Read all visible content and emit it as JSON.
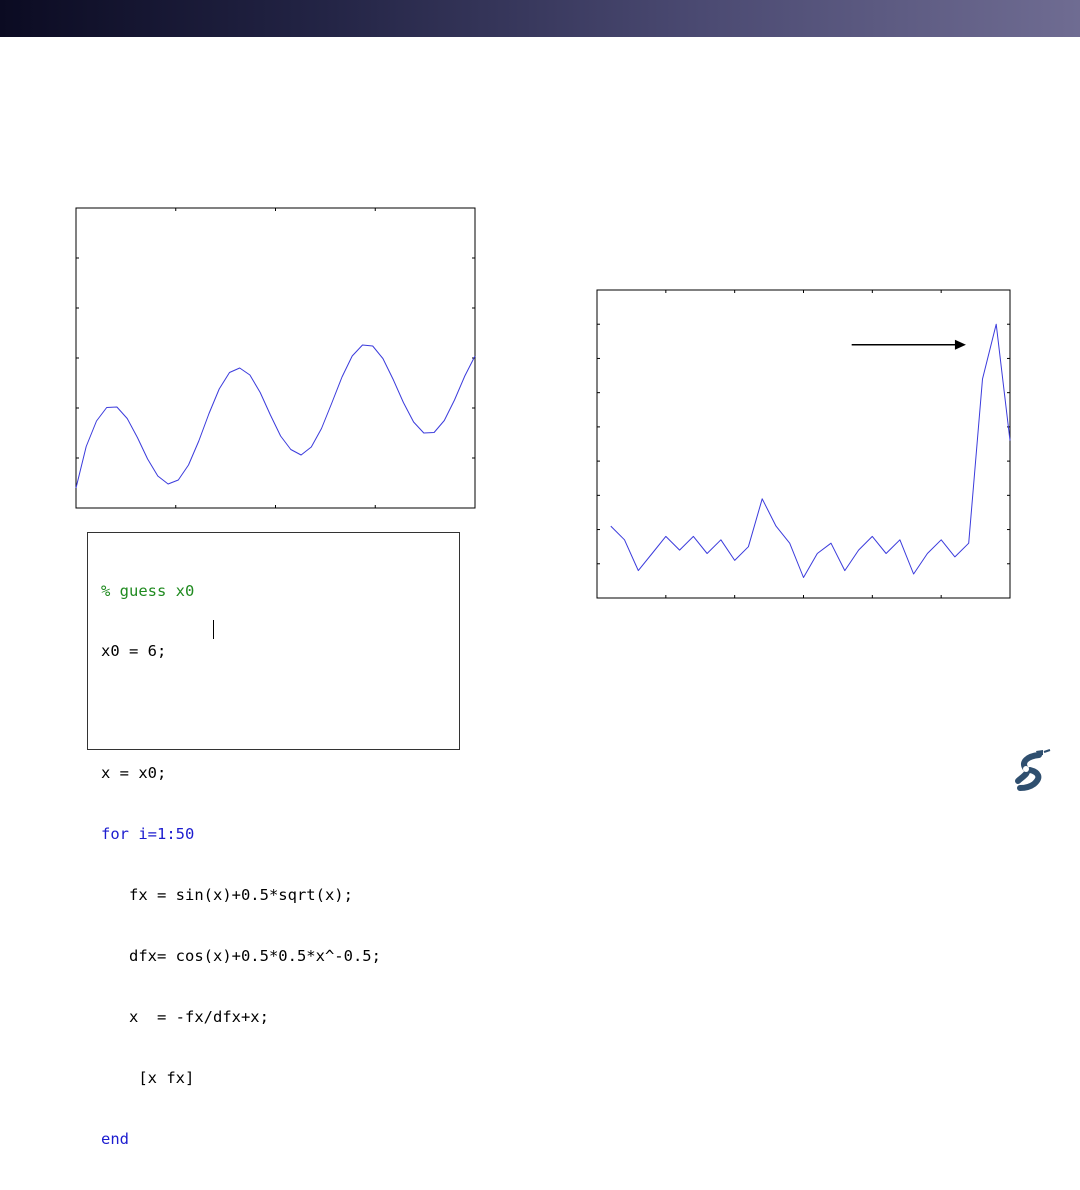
{
  "colors": {
    "header_bar_start": "#0b0b22",
    "header_bar_end": "#6f6c92",
    "series_line": "#3b3bdc",
    "code_comment": "#1f8a1f",
    "code_keyword": "#1c1ccf"
  },
  "chart_data": [
    {
      "type": "line",
      "title": "",
      "xlabel": "",
      "ylabel": "",
      "grid": false,
      "tick_labels_shown": false,
      "x_ticks": 3,
      "y_ticks": 5,
      "xlim": [
        0,
        19.5
      ],
      "ylim": [
        -0.4,
        5.6
      ],
      "series": [
        {
          "function": "sin(x)+0.5*sqrt(x)",
          "x": [
            0,
            0.5,
            1,
            1.5,
            2,
            2.5,
            3,
            3.5,
            4,
            4.5,
            5,
            5.5,
            6,
            6.5,
            7,
            7.5,
            8,
            8.5,
            9,
            9.5,
            10,
            10.5,
            11,
            11.5,
            12,
            12.5,
            13,
            13.5,
            14,
            14.5,
            15,
            15.5,
            16,
            16.5,
            17,
            17.5,
            18,
            18.5,
            19,
            19.5
          ],
          "y": [
            0.0,
            0.83,
            1.34,
            1.61,
            1.62,
            1.39,
            1.01,
            0.58,
            0.24,
            0.08,
            0.16,
            0.46,
            0.94,
            1.49,
            1.98,
            2.31,
            2.4,
            2.26,
            1.91,
            1.46,
            1.04,
            0.77,
            0.66,
            0.82,
            1.19,
            1.7,
            2.22,
            2.64,
            2.86,
            2.84,
            2.59,
            2.17,
            1.71,
            1.32,
            1.1,
            1.11,
            1.35,
            1.76,
            2.24,
            2.64
          ]
        }
      ]
    },
    {
      "type": "line",
      "title": "",
      "xlabel": "",
      "ylabel": "",
      "grid": false,
      "tick_labels_shown": false,
      "x_ticks": 5,
      "y_ticks": 8,
      "xlim": [
        0,
        30
      ],
      "ylim": [
        0,
        9
      ],
      "annotations": [
        {
          "type": "arrow",
          "from": [
            18.5,
            7.4
          ],
          "to": [
            26.8,
            7.4
          ],
          "text": ""
        }
      ],
      "series": [
        {
          "x": [
            1,
            2,
            3,
            4,
            5,
            6,
            7,
            8,
            9,
            10,
            11,
            12,
            13,
            14,
            15,
            16,
            17,
            18,
            19,
            20,
            21,
            22,
            23,
            24,
            25,
            26,
            27,
            28,
            29,
            30
          ],
          "y": [
            2.1,
            1.7,
            0.8,
            1.3,
            1.8,
            1.4,
            1.8,
            1.3,
            1.7,
            1.1,
            1.5,
            2.9,
            2.1,
            1.6,
            0.6,
            1.3,
            1.6,
            0.8,
            1.4,
            1.8,
            1.3,
            1.7,
            0.7,
            1.3,
            1.7,
            1.2,
            1.6,
            6.4,
            8.0,
            4.6
          ]
        }
      ]
    }
  ],
  "code": {
    "lines": [
      {
        "text": "% guess x0",
        "kind": "comment"
      },
      {
        "text": "x0 = 6;",
        "kind": "plain"
      },
      {
        "text": "",
        "kind": "plain"
      },
      {
        "text": "x = x0;",
        "kind": "plain"
      },
      {
        "text": "for i=1:50",
        "kind": "keyword"
      },
      {
        "text": "   fx = sin(x)+0.5*sqrt(x);",
        "kind": "plain"
      },
      {
        "text": "   dfx= cos(x)+0.5*0.5*x^-0.5;",
        "kind": "plain"
      },
      {
        "text": "   x  = -fx/dfx+x;",
        "kind": "plain"
      },
      {
        "text": "    [x fx]",
        "kind": "plain"
      },
      {
        "text": "end",
        "kind": "keyword"
      }
    ]
  },
  "logo": {
    "icon": "robot-arm-logo-icon"
  }
}
